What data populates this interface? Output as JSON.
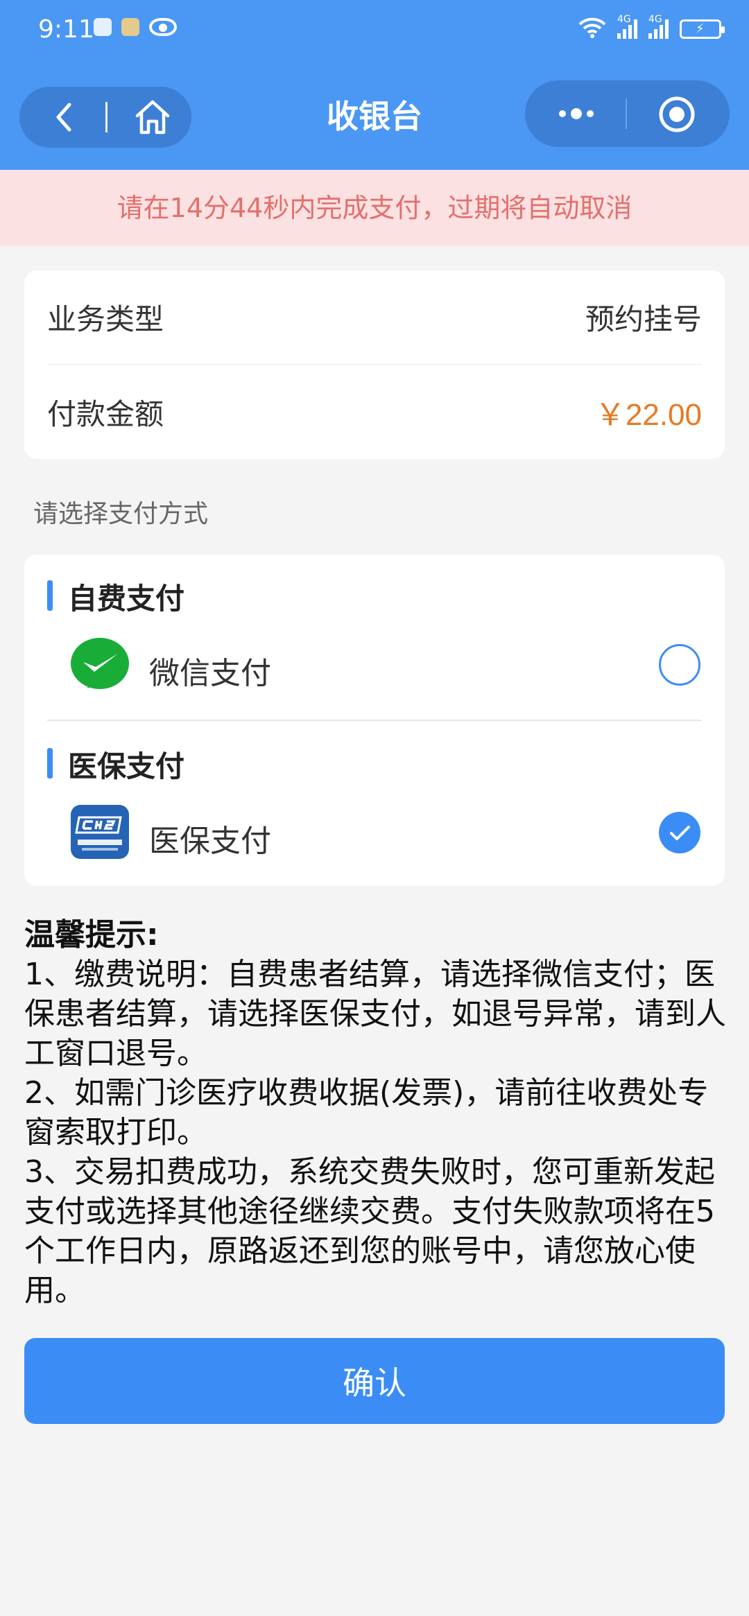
{
  "status_bar": {
    "time": "9:11",
    "network_tag_1": "4G",
    "network_tag_2": "4G"
  },
  "header": {
    "title": "收银台"
  },
  "countdown": {
    "text": "请在14分44秒内完成支付，过期将自动取消"
  },
  "order": {
    "business_type_label": "业务类型",
    "business_type_value": "预约挂号",
    "amount_label": "付款金额",
    "amount_value": "￥22.00"
  },
  "payment": {
    "section_hint": "请选择支付方式",
    "groups": [
      {
        "title": "自费支付",
        "option_label": "微信支付",
        "icon": "wechat-pay-icon",
        "selected": false
      },
      {
        "title": "医保支付",
        "option_label": "医保支付",
        "icon": "chs-medical-insurance-icon",
        "selected": true
      }
    ]
  },
  "tips": {
    "title": "温馨提示:",
    "lines": [
      "1、缴费说明：自费患者结算，请选择微信支付；医保患者结算，请选择医保支付，如退号异常，请到人工窗口退号。",
      "2、如需门诊医疗收费收据(发票)，请前往收费处专窗索取打印。",
      "3、交易扣费成功，系统交费失败时，您可重新发起支付或选择其他途径继续交费。支付失败款项将在5个工作日内，原路返还到您的账号中，请您放心使用。"
    ]
  },
  "confirm": {
    "label": "确认"
  },
  "colors": {
    "header_blue": "#4a97f4",
    "accent_blue": "#3b8df5",
    "amount_orange": "#e67a24",
    "banner_bg": "#fbe1e1",
    "banner_text": "#e2706d"
  }
}
